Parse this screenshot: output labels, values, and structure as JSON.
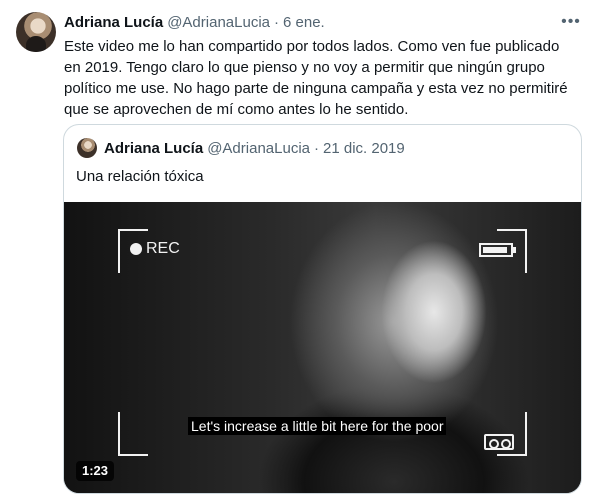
{
  "tweet": {
    "author_name": "Adriana Lucía",
    "handle": "@AdrianaLucia",
    "separator": "·",
    "date": "6 ene.",
    "more_icon": "more-horizontal-icon",
    "text_lines": [
      "Este video me lo han compartido por todos lados. Como ven fue publicado",
      "en 2019. Tengo claro lo que pienso y  no voy a permitir que ningún grupo",
      "político me use. No hago parte de ninguna campaña y esta vez no permitiré",
      "que se aprovechen de mí como antes lo he sentido."
    ]
  },
  "quote": {
    "author_name": "Adriana Lucía",
    "handle": "@AdrianaLucia",
    "separator": "·",
    "date": "21 dic. 2019",
    "text": "Una relación tóxica",
    "video": {
      "rec_label": "REC",
      "subtitle": "Let's increase a little bit here for the poor",
      "duration": "1:23"
    }
  }
}
